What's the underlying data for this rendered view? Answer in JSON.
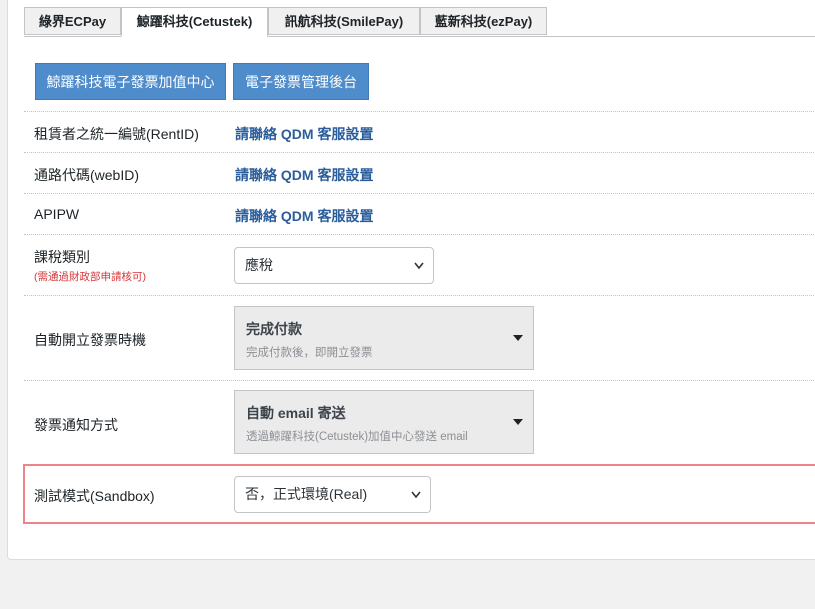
{
  "tabs": [
    {
      "label": "綠界ECPay",
      "active": false
    },
    {
      "label": "鯨躍科技(Cetustek)",
      "active": true
    },
    {
      "label": "訊航科技(SmilePay)",
      "active": false
    },
    {
      "label": "藍新科技(ezPay)",
      "active": false
    }
  ],
  "actions": {
    "center_button": "鯨躍科技電子發票加值中心",
    "backend_button": "電子發票管理後台"
  },
  "fields": {
    "rent_id": {
      "label": "租賃者之統一編號(RentID)",
      "value": "請聯絡 QDM 客服設置"
    },
    "web_id": {
      "label": "通路代碼(webID)",
      "value": "請聯絡 QDM 客服設置"
    },
    "apipw": {
      "label": "APIPW",
      "value": "請聯絡 QDM 客服設置"
    },
    "tax_type": {
      "label": "課稅類別",
      "note": "(需通過財政部申請核可)",
      "value": "應稅"
    },
    "issue_timing": {
      "label": "自動開立發票時機",
      "value": "完成付款",
      "description": "完成付款後，即開立發票"
    },
    "notify_method": {
      "label": "發票通知方式",
      "value": "自動 email 寄送",
      "description": "透過鯨躍科技(Cetustek)加值中心發送 email"
    },
    "sandbox": {
      "label": "測試模式(Sandbox)",
      "value": "否，正式環境(Real)"
    }
  },
  "colors": {
    "primary_button": "#4f8ccb",
    "link": "#2a5d9b",
    "required_note": "#d63638",
    "highlight_border": "#f0838a"
  }
}
